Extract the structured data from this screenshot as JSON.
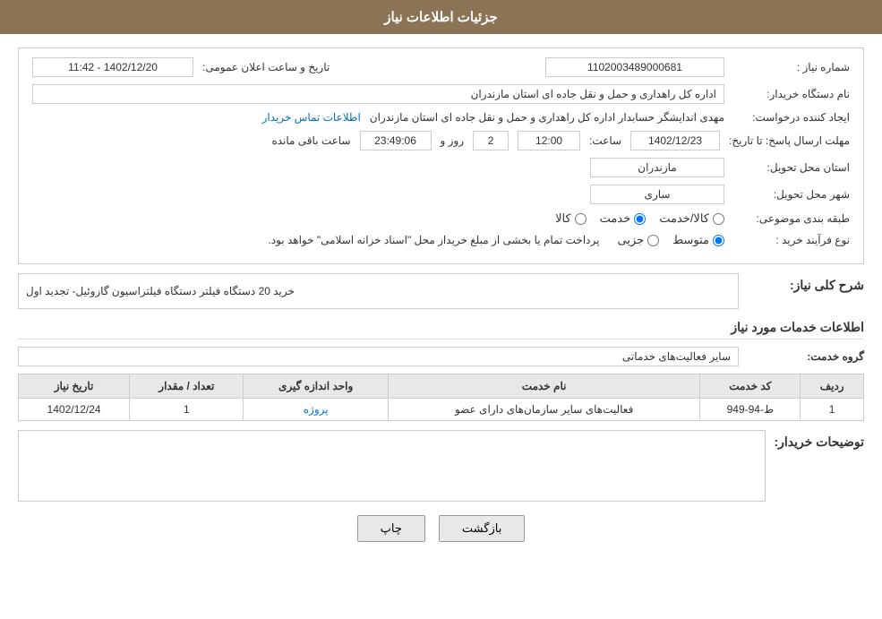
{
  "header": {
    "title": "جزئیات اطلاعات نیاز"
  },
  "fields": {
    "need_number_label": "شماره نیاز :",
    "need_number_value": "1102003489000681",
    "buyer_name_label": "نام دستگاه خریدار:",
    "buyer_name_value": "اداره کل راهداری و حمل و نقل جاده ای استان مازندران",
    "creator_label": "ایجاد کننده درخواست:",
    "creator_value": "مهدی اندایشگر حسابدار اداره کل راهداری و حمل و نقل جاده ای استان مازندران",
    "creator_link": "اطلاعات تماس خریدار",
    "deadline_label": "مهلت ارسال پاسخ: تا تاریخ:",
    "deadline_date": "1402/12/23",
    "deadline_time_label": "ساعت:",
    "deadline_time": "12:00",
    "deadline_days_label": "روز و",
    "deadline_days": "2",
    "deadline_remaining_label": "ساعت باقی مانده",
    "deadline_remaining": "23:49:06",
    "province_label": "استان محل تحویل:",
    "province_value": "مازندران",
    "city_label": "شهر محل تحویل:",
    "city_value": "ساری",
    "category_label": "طبقه بندی موضوعی:",
    "category_options": [
      {
        "label": "کالا",
        "selected": false
      },
      {
        "label": "خدمت",
        "selected": true
      },
      {
        "label": "کالا/خدمت",
        "selected": false
      }
    ],
    "process_label": "نوع فرآیند خرید :",
    "process_options": [
      {
        "label": "جزیی",
        "selected": false
      },
      {
        "label": "متوسط",
        "selected": true
      }
    ],
    "process_note": "پرداخت تمام یا بخشی از مبلغ خریداز محل \"اسناد خزانه اسلامی\" خواهد بود.",
    "announce_datetime_label": "تاریخ و ساعت اعلان عمومی:",
    "announce_datetime_value": "1402/12/20 - 11:42"
  },
  "need_section": {
    "title": "شرح کلی نیاز:",
    "value": "خرید 20 دستگاه فیلتر دستگاه فیلتراسیون گازوئیل- تجدید اول"
  },
  "services_section": {
    "title": "اطلاعات خدمات مورد نیاز",
    "group_label": "گروه خدمت:",
    "group_value": "سایر فعالیت‌های خدماتی",
    "table": {
      "columns": [
        "ردیف",
        "کد خدمت",
        "نام خدمت",
        "واحد اندازه گیری",
        "تعداد / مقدار",
        "تاریخ نیاز"
      ],
      "rows": [
        {
          "row": "1",
          "code": "ط-94-949",
          "name": "فعالیت‌های سایر سازمان‌های دارای عضو",
          "unit": "پروژه",
          "quantity": "1",
          "date": "1402/12/24"
        }
      ]
    }
  },
  "buyer_desc": {
    "label": "توضیحات خریدار:",
    "value": ""
  },
  "buttons": {
    "print": "چاپ",
    "back": "بازگشت"
  }
}
